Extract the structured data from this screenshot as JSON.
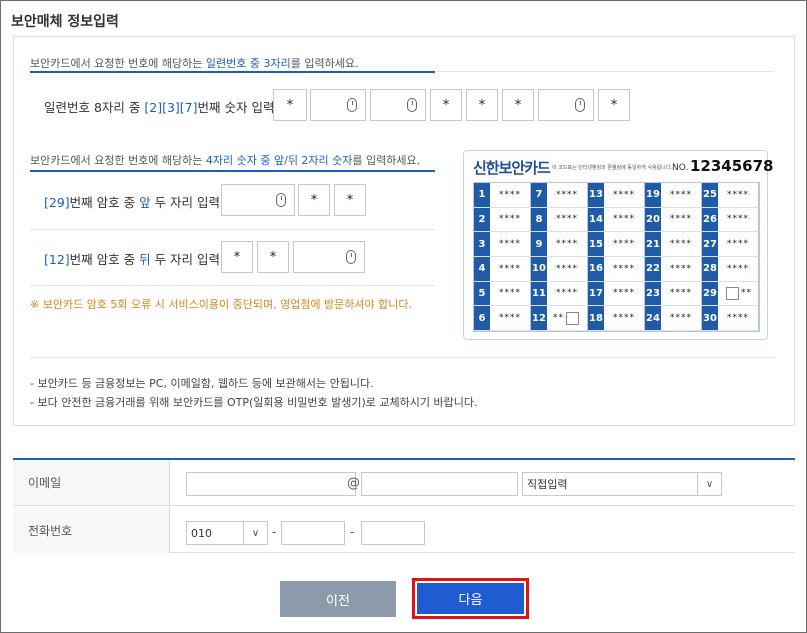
{
  "title": "보안매체 정보입력",
  "serial": {
    "instruction_pre": "보안카드에서 요청한 번호에 해당하는 ",
    "instruction_hl": "일련번호 중 3자리",
    "instruction_post": "를 입력하세요.",
    "label_pre": "일련번호 8자리 중 ",
    "label_hl": "[2][3][7]",
    "label_post": "번째 숫자 입력",
    "cells": [
      "*",
      "",
      "",
      "*",
      "*",
      "*",
      "",
      "*"
    ]
  },
  "pin": {
    "instruction_pre": "보안카드에서 요청한 번호에 해당하는 ",
    "instruction_hl": "4자리 숫자 중 앞/뒤 2자리 숫자",
    "instruction_post": "를 입력하세요.",
    "row1_hl": "[29]",
    "row1_mid": "번째 암호 중 ",
    "row1_pos": "앞",
    "row1_post": " 두 자리 입력",
    "row1_cells": [
      "",
      "*",
      "*"
    ],
    "row2_hl": "[12]",
    "row2_mid": "번째 암호 중 ",
    "row2_pos": "뒤",
    "row2_post": " 두 자리 입력",
    "row2_cells": [
      "*",
      "*",
      ""
    ],
    "warning": "※ 보안카드 암호 5회 오류 시 서비스이용이 중단되며, 영업점에 방문하셔야 합니다."
  },
  "card": {
    "brand": "신한보안카드",
    "subtitle": "이 코드표는 인터넷뱅킹과 폰뱅킹에 동일하게 사용됩니다.",
    "no_label": "NO.",
    "no_value": "12345678",
    "mask": "****",
    "partial_mask": "**",
    "numbers": [
      1,
      7,
      13,
      19,
      25,
      2,
      8,
      14,
      20,
      26,
      3,
      9,
      15,
      21,
      27,
      4,
      10,
      16,
      22,
      28,
      5,
      11,
      17,
      23,
      29,
      6,
      12,
      18,
      24,
      30
    ]
  },
  "notes": [
    "- 보안카드 등 금융정보는 PC, 이메일함, 웹하드 등에 보관해서는 안됩니다.",
    "- 보다 안전한 금융거래를 위해 보안카드를 OTP(일회용 비밀번호 발생기)로 교체하시기 바랍니다."
  ],
  "form": {
    "email_label": "이메일",
    "email_at": "@",
    "email_domain_select": "직접입력",
    "phone_label": "전화번호",
    "phone_prefix": "010",
    "phone_dash": "-"
  },
  "buttons": {
    "prev": "이전",
    "next": "다음"
  },
  "colors": {
    "accent": "#1a5fbf",
    "warning": "#d4871b",
    "next_button": "#1f5bd1",
    "prev_button": "#8c9aac",
    "highlight_outline": "#e0121b"
  }
}
